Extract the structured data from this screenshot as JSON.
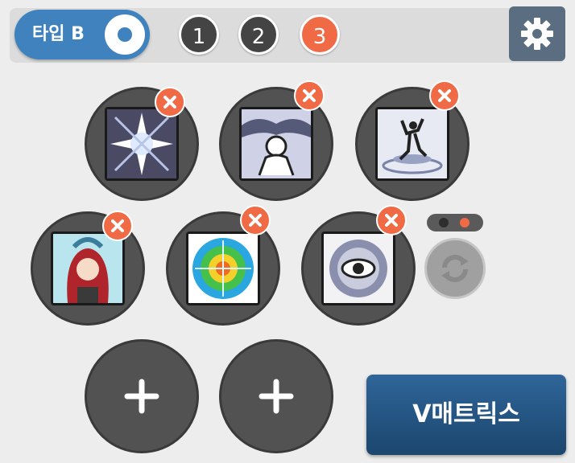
{
  "type_toggle": {
    "label": "타입 B",
    "enabled": true
  },
  "pages": [
    {
      "label": "1",
      "active": false
    },
    {
      "label": "2",
      "active": false
    },
    {
      "label": "3",
      "active": true
    }
  ],
  "colors": {
    "accent_blue": "#3f82bd",
    "active_page": "#ef6a45",
    "inactive_page": "#444444",
    "remove": "#ef6a45",
    "slot": "#525252",
    "settings_bg": "#5b6d81",
    "vmatrix_top": "#2f6599",
    "vmatrix_bottom": "#1b466e"
  },
  "icons": {
    "settings": "gear-icon",
    "remove": "close-icon",
    "add": "plus-icon",
    "refresh": "refresh-icon"
  },
  "skill_slots": [
    {
      "state": "filled",
      "icon": "light-burst-skill-icon"
    },
    {
      "state": "filled",
      "icon": "storm-silhouette-skill-icon"
    },
    {
      "state": "filled",
      "icon": "warrior-stance-skill-icon"
    },
    {
      "state": "filled",
      "icon": "red-hair-character-skill-icon"
    },
    {
      "state": "filled",
      "icon": "magic-circle-skill-icon"
    },
    {
      "state": "filled",
      "icon": "dark-eye-skill-icon"
    },
    {
      "state": "empty",
      "icon": "plus-icon"
    },
    {
      "state": "empty",
      "icon": "plus-icon"
    }
  ],
  "slot_pager": {
    "count": 2,
    "active_index": 1
  },
  "vmatrix_button": {
    "label": "V매트릭스"
  }
}
